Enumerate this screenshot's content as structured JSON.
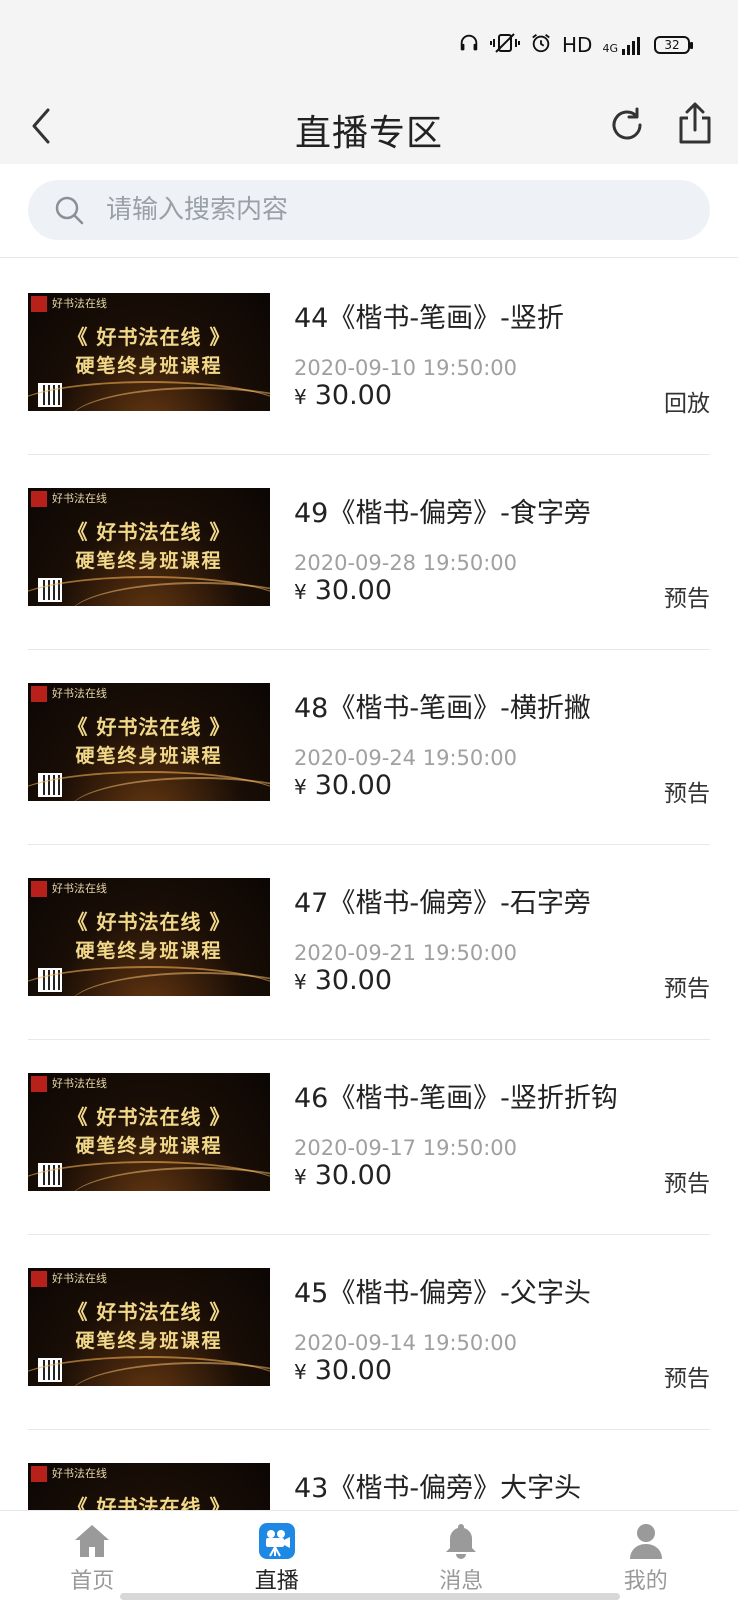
{
  "status_bar": {
    "network_label": "HD",
    "signal_label": "4G",
    "battery_level": "32",
    "icons": [
      "headphones-icon",
      "vibrate-icon",
      "alarm-icon",
      "signal-icon",
      "battery-icon"
    ]
  },
  "nav": {
    "title": "直播专区",
    "back_icon": "back-arrow-icon",
    "refresh_icon": "refresh-icon",
    "share_icon": "share-icon"
  },
  "search": {
    "placeholder": "请输入搜索内容",
    "value": ""
  },
  "thumbnail": {
    "brand": "好书法在线",
    "line1": "《 好书法在线 》",
    "line2": "硬笔终身班课程"
  },
  "items": [
    {
      "title": "44《楷书-笔画》-竖折",
      "date": "2020-09-10 19:50:00",
      "currency": "¥",
      "price": "30.00",
      "status": "回放"
    },
    {
      "title": "49《楷书-偏旁》-食字旁",
      "date": "2020-09-28 19:50:00",
      "currency": "¥",
      "price": "30.00",
      "status": "预告"
    },
    {
      "title": "48《楷书-笔画》-横折撇",
      "date": "2020-09-24 19:50:00",
      "currency": "¥",
      "price": "30.00",
      "status": "预告"
    },
    {
      "title": "47《楷书-偏旁》-石字旁",
      "date": "2020-09-21 19:50:00",
      "currency": "¥",
      "price": "30.00",
      "status": "预告"
    },
    {
      "title": "46《楷书-笔画》-竖折折钩",
      "date": "2020-09-17 19:50:00",
      "currency": "¥",
      "price": "30.00",
      "status": "预告"
    },
    {
      "title": "45《楷书-偏旁》-父字头",
      "date": "2020-09-14 19:50:00",
      "currency": "¥",
      "price": "30.00",
      "status": "预告"
    },
    {
      "title": "43《楷书-偏旁》大字头",
      "date": "",
      "currency": "",
      "price": "",
      "status": ""
    }
  ],
  "tabs": [
    {
      "label": "首页",
      "icon": "home-icon",
      "active": false
    },
    {
      "label": "直播",
      "icon": "video-camera-icon",
      "active": true
    },
    {
      "label": "消息",
      "icon": "bell-icon",
      "active": false
    },
    {
      "label": "我的",
      "icon": "user-icon",
      "active": false
    }
  ],
  "colors": {
    "accent": "#1e88e5",
    "inactive_tab": "#999999",
    "date_gray": "#a0a0a0",
    "search_bg": "#eef2f7"
  }
}
